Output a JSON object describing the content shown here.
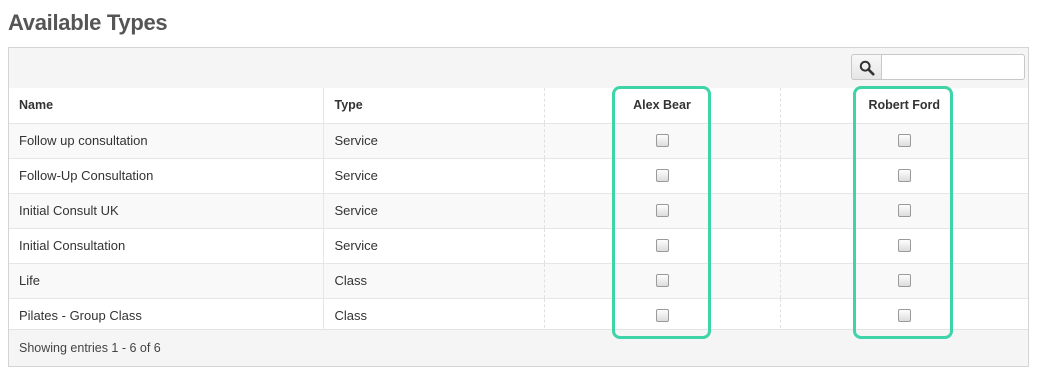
{
  "page": {
    "title": "Available Types"
  },
  "search": {
    "placeholder": "",
    "value": "",
    "icon": "search-icon"
  },
  "table": {
    "columns": [
      "Name",
      "Type",
      "Alex Bear",
      "Robert Ford"
    ],
    "rows": [
      {
        "name": "Follow up consultation",
        "type": "Service",
        "alex_checked": false,
        "robert_checked": false
      },
      {
        "name": "Follow-Up Consultation",
        "type": "Service",
        "alex_checked": false,
        "robert_checked": false
      },
      {
        "name": "Initial Consult UK",
        "type": "Service",
        "alex_checked": false,
        "robert_checked": false
      },
      {
        "name": "Initial Consultation",
        "type": "Service",
        "alex_checked": false,
        "robert_checked": false
      },
      {
        "name": "Life",
        "type": "Class",
        "alex_checked": false,
        "robert_checked": false
      },
      {
        "name": "Pilates - Group Class",
        "type": "Class",
        "alex_checked": false,
        "robert_checked": false
      }
    ]
  },
  "footer": {
    "info": "Showing entries 1 - 6 of 6"
  },
  "colors": {
    "highlight": "#3fd3a8",
    "title": "#555555"
  }
}
